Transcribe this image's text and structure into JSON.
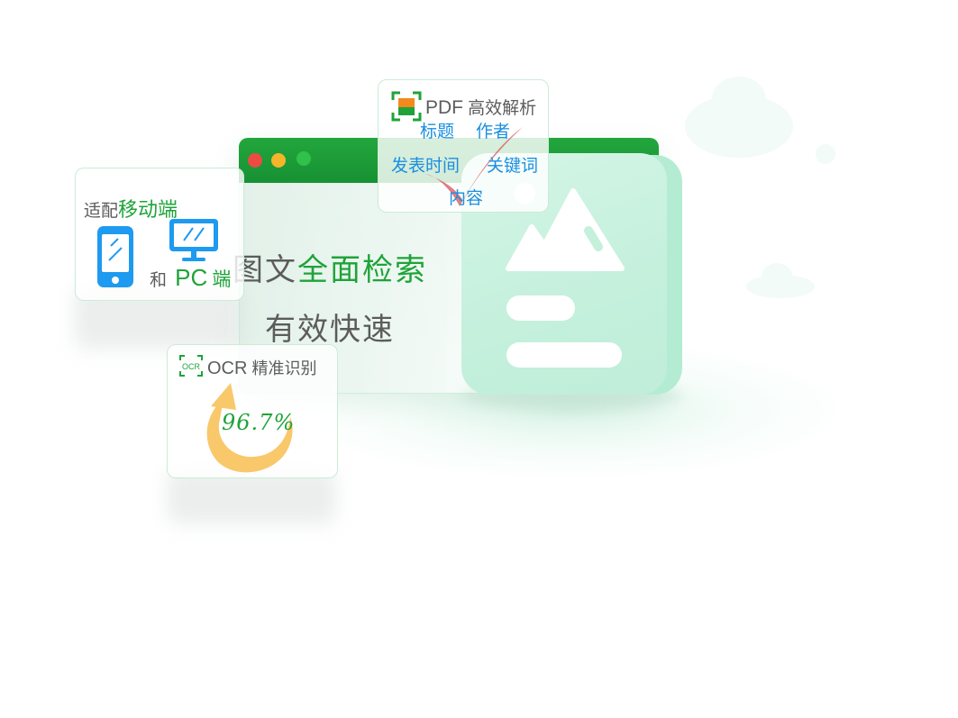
{
  "window": {
    "dots": {
      "close": "#ec4b43",
      "minimize": "#f5b52a",
      "maximize": "#30c14a"
    },
    "headline_part1": "图文",
    "headline_part2": "全面检索",
    "subline": "有效快速"
  },
  "mobile_card": {
    "prefix": "适配",
    "highlight": "移动端",
    "and_text": "和",
    "pc_label": "PC",
    "pc_suffix": "端"
  },
  "pdf_card": {
    "icon_label": "PDF",
    "title": "高效解析",
    "tags": [
      "标题",
      "作者",
      "发表时间",
      "关键词",
      "内容"
    ]
  },
  "ocr_card": {
    "icon_label": "OCR",
    "title_label": "OCR",
    "title": "精准识别",
    "accuracy": "96.7%"
  },
  "colors": {
    "brand_green": "#1fa339",
    "mint": "#c4f0dc",
    "device_blue": "#1e9af0",
    "accent_orange": "#f8c86a",
    "check_red": "#d7525d"
  }
}
